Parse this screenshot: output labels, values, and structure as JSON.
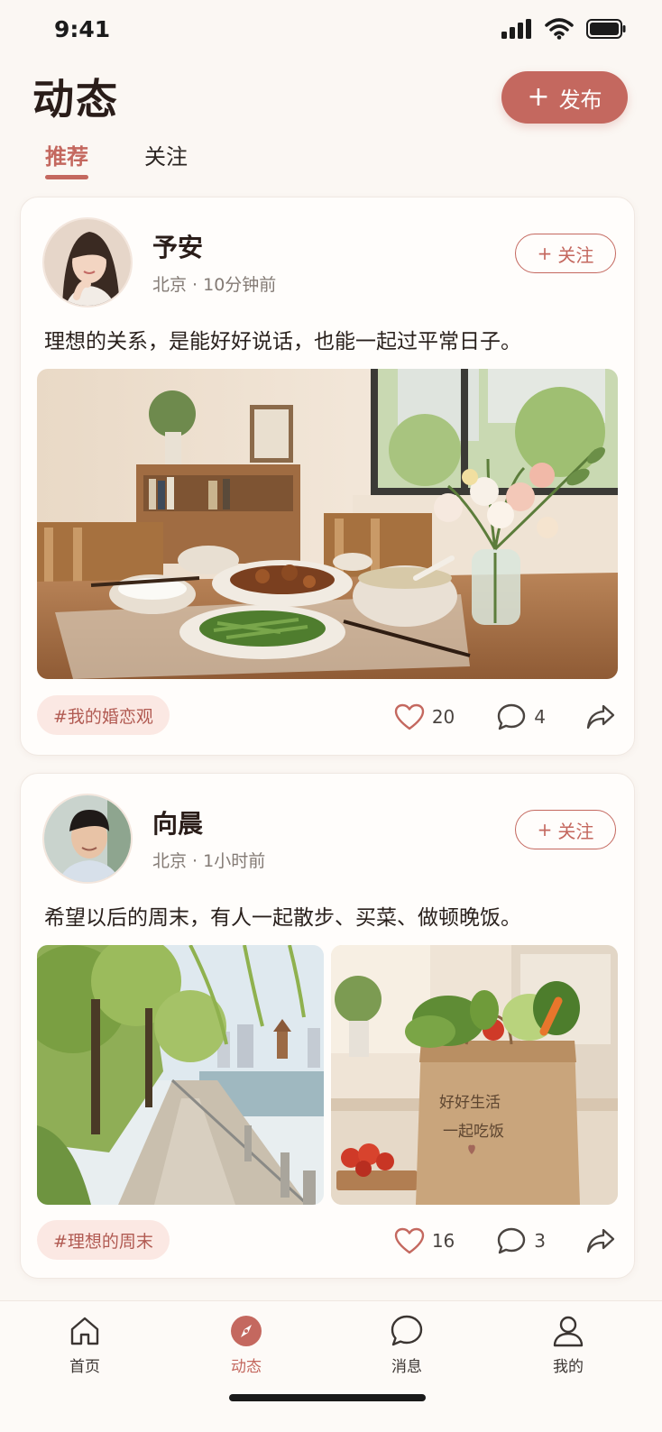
{
  "status_bar": {
    "time": "9:41"
  },
  "header": {
    "title": "动态",
    "publish_label": "发布"
  },
  "tabs": [
    {
      "label": "推荐",
      "active": true
    },
    {
      "label": "关注",
      "active": false
    }
  ],
  "posts": [
    {
      "user": "予安",
      "meta": "北京 · 10分钟前",
      "follow_label": "关注",
      "text": "理想的关系，是能好好说话，也能一起过平常日子。",
      "tag": "#我的婚恋观",
      "likes": "20",
      "comments": "4"
    },
    {
      "user": "向晨",
      "meta": "北京 · 1小时前",
      "follow_label": "关注",
      "text": "希望以后的周末，有人一起散步、买菜、做顿晚饭。",
      "tag": "#理想的周末",
      "likes": "16",
      "comments": "3",
      "bag_text": [
        "好好生活",
        "一起吃饭"
      ]
    }
  ],
  "nav": [
    {
      "label": "首页",
      "icon": "home-icon",
      "active": false
    },
    {
      "label": "动态",
      "icon": "compass-icon",
      "active": true
    },
    {
      "label": "消息",
      "icon": "message-icon",
      "active": false
    },
    {
      "label": "我的",
      "icon": "profile-icon",
      "active": false
    }
  ],
  "colors": {
    "accent": "#c4685f",
    "background": "#fbf7f3",
    "tag_bg": "#fbe8e3"
  }
}
